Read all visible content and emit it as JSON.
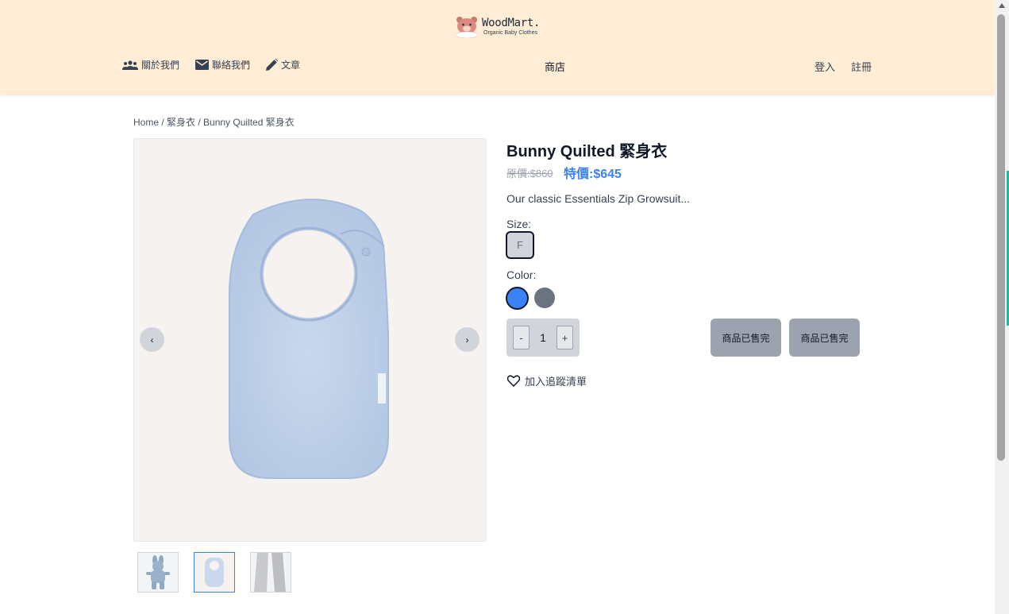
{
  "header": {
    "logo_name": "WoodMart.",
    "logo_tagline": "Organic Baby Clothes",
    "nav_left": [
      {
        "label": "關於我們",
        "icon": "people-icon"
      },
      {
        "label": "聯絡我們",
        "icon": "mail-icon"
      },
      {
        "label": "文章",
        "icon": "pencil-icon"
      }
    ],
    "nav_center": "商店",
    "nav_right": [
      "登入",
      "註冊"
    ]
  },
  "breadcrumb": "Home / 緊身衣 / Bunny Quilted 緊身衣",
  "gallery": {
    "prev": "‹",
    "next": "›",
    "thumbnails": [
      "bunny-suit",
      "bib",
      "grey-fabric"
    ],
    "active_index": 1
  },
  "product": {
    "title": "Bunny Quilted 緊身衣",
    "price_original": "原價:$860",
    "price_sale": "特價:$645",
    "description": "Our classic Essentials Zip Growsuit...",
    "size_label": "Size:",
    "sizes": [
      "F"
    ],
    "color_label": "Color:",
    "colors": [
      "#3b82f6",
      "#6b7280"
    ],
    "quantity": {
      "minus": "-",
      "value": "1",
      "plus": "+"
    },
    "buttons": [
      "商品已售完",
      "商品已售完"
    ],
    "wishlist": "加入追蹤清單"
  }
}
